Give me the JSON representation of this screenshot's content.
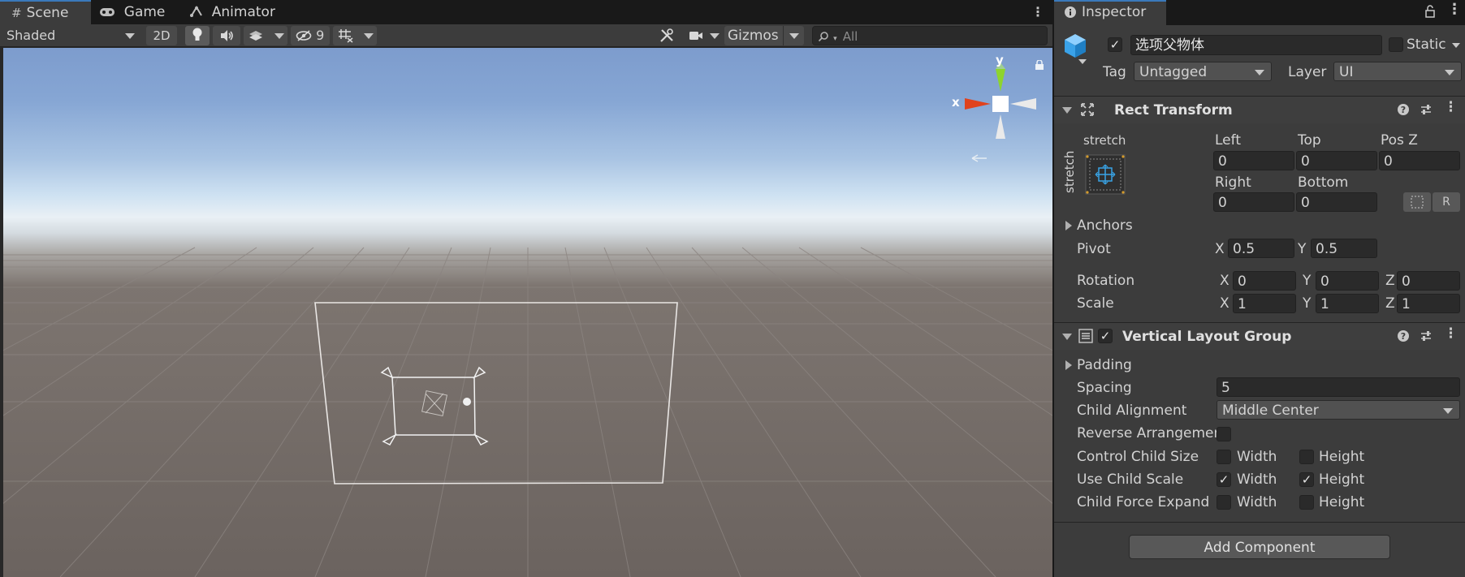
{
  "scene": {
    "tabs": [
      {
        "label": "Scene",
        "icon": "grid-icon"
      },
      {
        "label": "Game",
        "icon": "gamepad-icon"
      },
      {
        "label": "Animator",
        "icon": "animator-icon"
      }
    ],
    "toolbar": {
      "shading_mode": "Shaded",
      "mode_2d": "2D",
      "hidden_count": "9",
      "gizmos_label": "Gizmos",
      "search_placeholder": "All"
    },
    "gizmo": {
      "x_label": "x",
      "y_label": "y"
    }
  },
  "inspector": {
    "tab_label": "Inspector",
    "object": {
      "name": "选项父物体",
      "active": true,
      "static_label": "Static",
      "static": false,
      "tag_label": "Tag",
      "tag_value": "Untagged",
      "layer_label": "Layer",
      "layer_value": "UI"
    },
    "rect_transform": {
      "title": "Rect Transform",
      "anchor_preset_top": "stretch",
      "anchor_preset_side": "stretch",
      "left_label": "Left",
      "left": "0",
      "top_label": "Top",
      "top": "0",
      "posz_label": "Pos Z",
      "posz": "0",
      "right_label": "Right",
      "right": "0",
      "bottom_label": "Bottom",
      "bottom": "0",
      "raw_button": "R",
      "anchors_label": "Anchors",
      "pivot_label": "Pivot",
      "pivot_x": "0.5",
      "pivot_y": "0.5",
      "rotation_label": "Rotation",
      "rot_x": "0",
      "rot_y": "0",
      "rot_z": "0",
      "scale_label": "Scale",
      "scale_x": "1",
      "scale_y": "1",
      "scale_z": "1",
      "axis_x": "X",
      "axis_y": "Y",
      "axis_z": "Z"
    },
    "vlg": {
      "title": "Vertical Layout Group",
      "enabled": true,
      "padding_label": "Padding",
      "spacing_label": "Spacing",
      "spacing": "5",
      "child_alignment_label": "Child Alignment",
      "child_alignment": "Middle Center",
      "reverse_label": "Reverse Arrangemen",
      "reverse": false,
      "width_label": "Width",
      "height_label": "Height",
      "rows": [
        {
          "label": "Control Child Size",
          "width": false,
          "height": false
        },
        {
          "label": "Use Child Scale",
          "width": true,
          "height": true
        },
        {
          "label": "Child Force Expand",
          "width": false,
          "height": false
        }
      ]
    },
    "add_component": "Add Component"
  }
}
